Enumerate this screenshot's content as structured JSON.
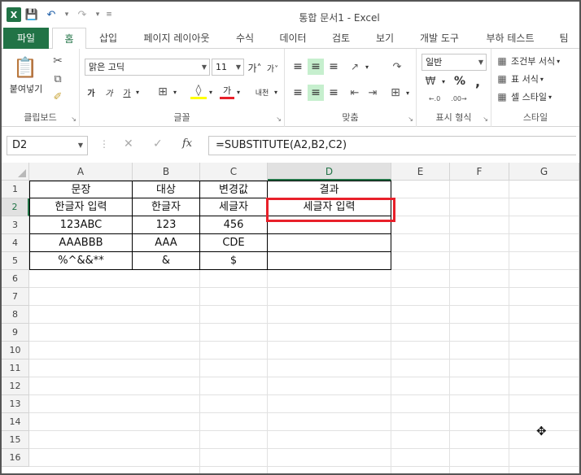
{
  "app": {
    "title": "통합 문서1 - Excel",
    "icons": [
      "excel-logo",
      "save-icon",
      "undo-icon",
      "redo-icon",
      "customize-icon"
    ]
  },
  "tabs": [
    "파일",
    "홈",
    "삽입",
    "페이지 레이아웃",
    "수식",
    "데이터",
    "검토",
    "보기",
    "개발 도구",
    "부하 테스트",
    "팀"
  ],
  "ribbon": {
    "clipboard": {
      "paste_label": "붙여넣기",
      "group_label": "클립보드"
    },
    "font": {
      "font_name": "맑은 고딕",
      "font_size": "11",
      "group_label": "글꼴",
      "bold": "가",
      "italic": "가",
      "underline": "가",
      "color_letter": "가",
      "phonetic": "내천"
    },
    "alignment": {
      "group_label": "맞춤"
    },
    "number": {
      "format": "일반",
      "group_label": "표시 형식",
      "percent": "%",
      "comma": ","
    },
    "styles": {
      "conditional": "조건부 서식",
      "table": "표 서식",
      "cell": "셀 스타일",
      "group_label": "스타일"
    }
  },
  "formula_bar": {
    "name_box": "D2",
    "formula": "=SUBSTITUTE(A2,B2,C2)",
    "fx": "fx"
  },
  "sheet": {
    "columns": [
      "A",
      "B",
      "C",
      "D",
      "E",
      "F",
      "G"
    ],
    "rows": [
      "1",
      "2",
      "3",
      "4",
      "5",
      "6",
      "7",
      "8",
      "9",
      "10",
      "11",
      "12",
      "13",
      "14",
      "15",
      "16"
    ],
    "selected_cell": "D2",
    "data": [
      [
        "문장",
        "대상",
        "변경값",
        "결과"
      ],
      [
        "한글자 입력",
        "한글자",
        "세글자",
        "세글자 입력"
      ],
      [
        "123ABC",
        "123",
        "456",
        ""
      ],
      [
        "AAABBB",
        "AAA",
        "CDE",
        ""
      ],
      [
        "%^&&**",
        "&",
        "$",
        ""
      ]
    ]
  },
  "colors": {
    "accent": "#217346",
    "selection_outline": "#e8202a"
  }
}
